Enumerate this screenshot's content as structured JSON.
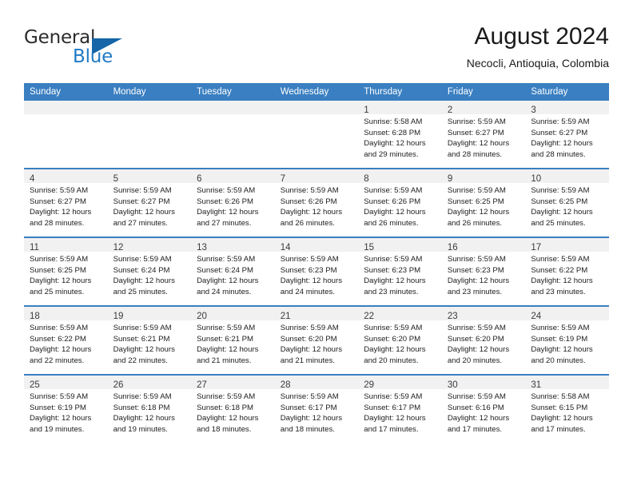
{
  "brand": {
    "name_part1": "General",
    "name_part2": "Blue",
    "logo_icon": "triangle-flag-icon",
    "accent_color": "#1565a8",
    "blue_text_color": "#1f7ac4"
  },
  "header": {
    "title": "August 2024",
    "subtitle": "Necocli, Antioquia, Colombia"
  },
  "theme": {
    "header_row_bg": "#3a7fc1",
    "daynum_band_bg": "#f1f1f1",
    "row_separator": "#3a7fc1",
    "cell_bg": "#ffffff"
  },
  "weekday_headers": [
    "Sunday",
    "Monday",
    "Tuesday",
    "Wednesday",
    "Thursday",
    "Friday",
    "Saturday"
  ],
  "labels": {
    "sunrise_prefix": "Sunrise:",
    "sunset_prefix": "Sunset:",
    "daylight_prefix": "Daylight:"
  },
  "weeks": [
    [
      {
        "empty": true
      },
      {
        "empty": true
      },
      {
        "empty": true
      },
      {
        "empty": true
      },
      {
        "day": "1",
        "sunrise": "Sunrise: 5:58 AM",
        "sunset": "Sunset: 6:28 PM",
        "daylight_l1": "Daylight: 12 hours",
        "daylight_l2": "and 29 minutes."
      },
      {
        "day": "2",
        "sunrise": "Sunrise: 5:59 AM",
        "sunset": "Sunset: 6:27 PM",
        "daylight_l1": "Daylight: 12 hours",
        "daylight_l2": "and 28 minutes."
      },
      {
        "day": "3",
        "sunrise": "Sunrise: 5:59 AM",
        "sunset": "Sunset: 6:27 PM",
        "daylight_l1": "Daylight: 12 hours",
        "daylight_l2": "and 28 minutes."
      }
    ],
    [
      {
        "day": "4",
        "sunrise": "Sunrise: 5:59 AM",
        "sunset": "Sunset: 6:27 PM",
        "daylight_l1": "Daylight: 12 hours",
        "daylight_l2": "and 28 minutes."
      },
      {
        "day": "5",
        "sunrise": "Sunrise: 5:59 AM",
        "sunset": "Sunset: 6:27 PM",
        "daylight_l1": "Daylight: 12 hours",
        "daylight_l2": "and 27 minutes."
      },
      {
        "day": "6",
        "sunrise": "Sunrise: 5:59 AM",
        "sunset": "Sunset: 6:26 PM",
        "daylight_l1": "Daylight: 12 hours",
        "daylight_l2": "and 27 minutes."
      },
      {
        "day": "7",
        "sunrise": "Sunrise: 5:59 AM",
        "sunset": "Sunset: 6:26 PM",
        "daylight_l1": "Daylight: 12 hours",
        "daylight_l2": "and 26 minutes."
      },
      {
        "day": "8",
        "sunrise": "Sunrise: 5:59 AM",
        "sunset": "Sunset: 6:26 PM",
        "daylight_l1": "Daylight: 12 hours",
        "daylight_l2": "and 26 minutes."
      },
      {
        "day": "9",
        "sunrise": "Sunrise: 5:59 AM",
        "sunset": "Sunset: 6:25 PM",
        "daylight_l1": "Daylight: 12 hours",
        "daylight_l2": "and 26 minutes."
      },
      {
        "day": "10",
        "sunrise": "Sunrise: 5:59 AM",
        "sunset": "Sunset: 6:25 PM",
        "daylight_l1": "Daylight: 12 hours",
        "daylight_l2": "and 25 minutes."
      }
    ],
    [
      {
        "day": "11",
        "sunrise": "Sunrise: 5:59 AM",
        "sunset": "Sunset: 6:25 PM",
        "daylight_l1": "Daylight: 12 hours",
        "daylight_l2": "and 25 minutes."
      },
      {
        "day": "12",
        "sunrise": "Sunrise: 5:59 AM",
        "sunset": "Sunset: 6:24 PM",
        "daylight_l1": "Daylight: 12 hours",
        "daylight_l2": "and 25 minutes."
      },
      {
        "day": "13",
        "sunrise": "Sunrise: 5:59 AM",
        "sunset": "Sunset: 6:24 PM",
        "daylight_l1": "Daylight: 12 hours",
        "daylight_l2": "and 24 minutes."
      },
      {
        "day": "14",
        "sunrise": "Sunrise: 5:59 AM",
        "sunset": "Sunset: 6:23 PM",
        "daylight_l1": "Daylight: 12 hours",
        "daylight_l2": "and 24 minutes."
      },
      {
        "day": "15",
        "sunrise": "Sunrise: 5:59 AM",
        "sunset": "Sunset: 6:23 PM",
        "daylight_l1": "Daylight: 12 hours",
        "daylight_l2": "and 23 minutes."
      },
      {
        "day": "16",
        "sunrise": "Sunrise: 5:59 AM",
        "sunset": "Sunset: 6:23 PM",
        "daylight_l1": "Daylight: 12 hours",
        "daylight_l2": "and 23 minutes."
      },
      {
        "day": "17",
        "sunrise": "Sunrise: 5:59 AM",
        "sunset": "Sunset: 6:22 PM",
        "daylight_l1": "Daylight: 12 hours",
        "daylight_l2": "and 23 minutes."
      }
    ],
    [
      {
        "day": "18",
        "sunrise": "Sunrise: 5:59 AM",
        "sunset": "Sunset: 6:22 PM",
        "daylight_l1": "Daylight: 12 hours",
        "daylight_l2": "and 22 minutes."
      },
      {
        "day": "19",
        "sunrise": "Sunrise: 5:59 AM",
        "sunset": "Sunset: 6:21 PM",
        "daylight_l1": "Daylight: 12 hours",
        "daylight_l2": "and 22 minutes."
      },
      {
        "day": "20",
        "sunrise": "Sunrise: 5:59 AM",
        "sunset": "Sunset: 6:21 PM",
        "daylight_l1": "Daylight: 12 hours",
        "daylight_l2": "and 21 minutes."
      },
      {
        "day": "21",
        "sunrise": "Sunrise: 5:59 AM",
        "sunset": "Sunset: 6:20 PM",
        "daylight_l1": "Daylight: 12 hours",
        "daylight_l2": "and 21 minutes."
      },
      {
        "day": "22",
        "sunrise": "Sunrise: 5:59 AM",
        "sunset": "Sunset: 6:20 PM",
        "daylight_l1": "Daylight: 12 hours",
        "daylight_l2": "and 20 minutes."
      },
      {
        "day": "23",
        "sunrise": "Sunrise: 5:59 AM",
        "sunset": "Sunset: 6:20 PM",
        "daylight_l1": "Daylight: 12 hours",
        "daylight_l2": "and 20 minutes."
      },
      {
        "day": "24",
        "sunrise": "Sunrise: 5:59 AM",
        "sunset": "Sunset: 6:19 PM",
        "daylight_l1": "Daylight: 12 hours",
        "daylight_l2": "and 20 minutes."
      }
    ],
    [
      {
        "day": "25",
        "sunrise": "Sunrise: 5:59 AM",
        "sunset": "Sunset: 6:19 PM",
        "daylight_l1": "Daylight: 12 hours",
        "daylight_l2": "and 19 minutes."
      },
      {
        "day": "26",
        "sunrise": "Sunrise: 5:59 AM",
        "sunset": "Sunset: 6:18 PM",
        "daylight_l1": "Daylight: 12 hours",
        "daylight_l2": "and 19 minutes."
      },
      {
        "day": "27",
        "sunrise": "Sunrise: 5:59 AM",
        "sunset": "Sunset: 6:18 PM",
        "daylight_l1": "Daylight: 12 hours",
        "daylight_l2": "and 18 minutes."
      },
      {
        "day": "28",
        "sunrise": "Sunrise: 5:59 AM",
        "sunset": "Sunset: 6:17 PM",
        "daylight_l1": "Daylight: 12 hours",
        "daylight_l2": "and 18 minutes."
      },
      {
        "day": "29",
        "sunrise": "Sunrise: 5:59 AM",
        "sunset": "Sunset: 6:17 PM",
        "daylight_l1": "Daylight: 12 hours",
        "daylight_l2": "and 17 minutes."
      },
      {
        "day": "30",
        "sunrise": "Sunrise: 5:59 AM",
        "sunset": "Sunset: 6:16 PM",
        "daylight_l1": "Daylight: 12 hours",
        "daylight_l2": "and 17 minutes."
      },
      {
        "day": "31",
        "sunrise": "Sunrise: 5:58 AM",
        "sunset": "Sunset: 6:15 PM",
        "daylight_l1": "Daylight: 12 hours",
        "daylight_l2": "and 17 minutes."
      }
    ]
  ]
}
